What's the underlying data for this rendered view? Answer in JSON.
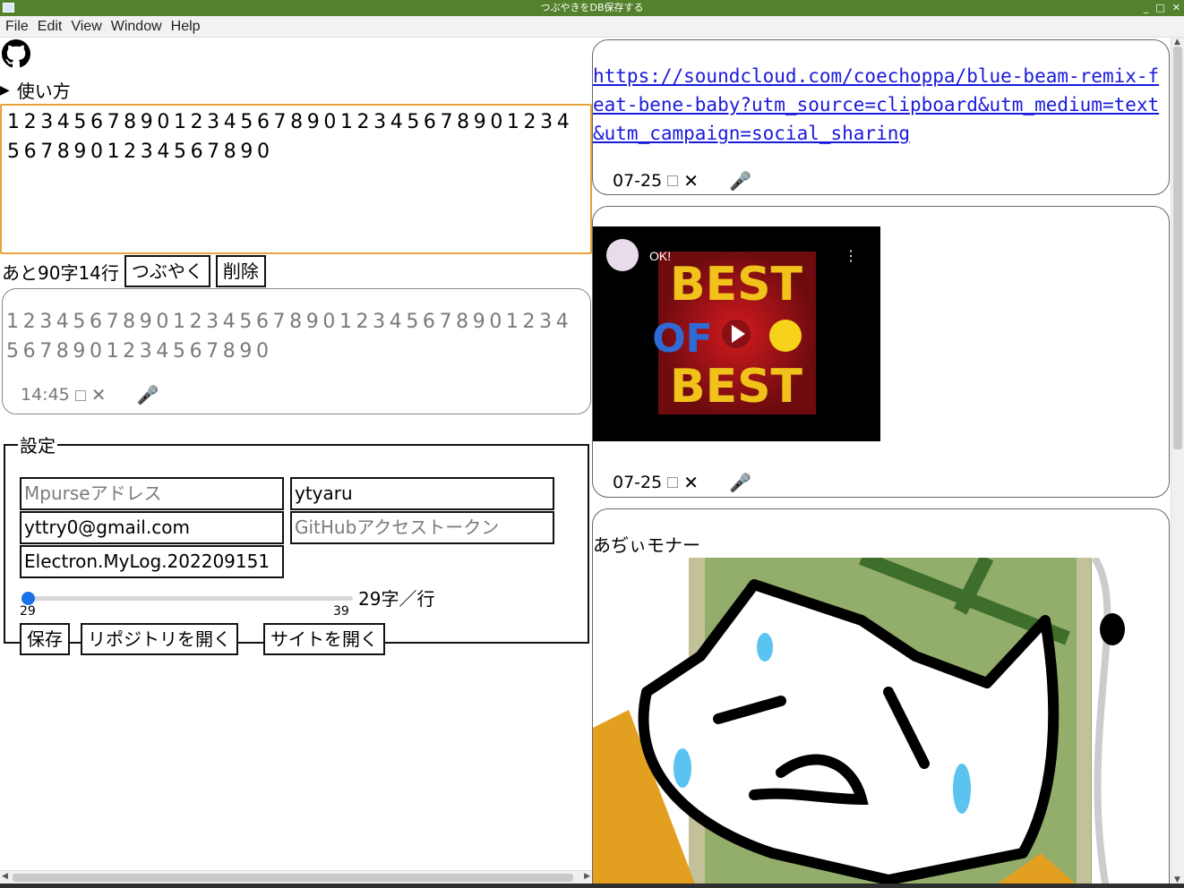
{
  "window": {
    "title": "つぶやきをDB保存する"
  },
  "menu": [
    "File",
    "Edit",
    "View",
    "Window",
    "Help"
  ],
  "howto": {
    "label": "使い方"
  },
  "editor": {
    "text": "12345678901234567890123456789012345678901234567890"
  },
  "status": {
    "remaining": "あと90字14行"
  },
  "buttons": {
    "tweet": "つぶやく",
    "delete": "削除",
    "save": "保存",
    "open_repo": "リポジトリを開く",
    "open_site": "サイトを開く"
  },
  "preview": {
    "text": "12345678901234567890123456789012345678901234567890",
    "time": "14:45"
  },
  "settings": {
    "legend": "設定",
    "mpurse_placeholder": "Mpurseアドレス",
    "username": "ytyaru",
    "email": "yttry0@gmail.com",
    "token_placeholder": "GitHubアクセストークン",
    "repo": "Electron.MyLog.202209151",
    "slider_value": 29,
    "slider_min": "29",
    "slider_max": "39",
    "slider_label": "29字／行"
  },
  "posts": [
    {
      "type": "link",
      "url": "https://soundcloud.com/coechoppa/blue-beam-remix-feat-bene-baby?utm_source=clipboard&utm_medium=text&utm_campaign=social_sharing",
      "date": "07-25"
    },
    {
      "type": "youtube",
      "video_title": "OK!",
      "thumb_text_1": "BEST",
      "thumb_text_2": "OF",
      "thumb_text_3": "BEST",
      "date": "07-25"
    },
    {
      "type": "image",
      "caption": "あぢぃモナー"
    }
  ],
  "icons": {
    "checkbox": "checkbox-icon",
    "close": "close-icon",
    "mic": "microphone-icon",
    "github": "github-icon"
  },
  "colors": {
    "titlebar": "#53812d",
    "editor_border": "#e8a33a",
    "link": "#1a1adb",
    "slider": "#1a73e8"
  }
}
